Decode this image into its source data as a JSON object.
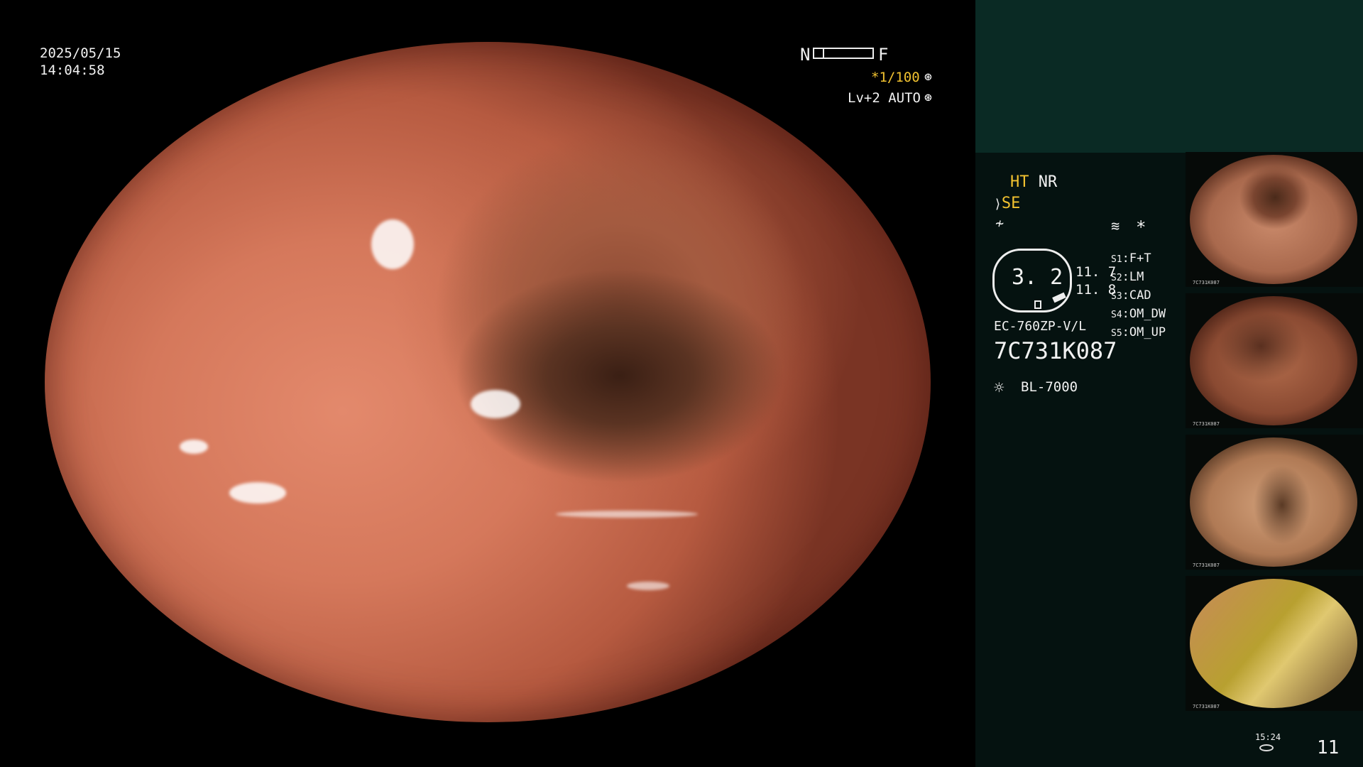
{
  "header": {
    "date": "2025/05/15",
    "time": "14:04:58"
  },
  "topright": {
    "near_label": "N",
    "far_label": "F",
    "shutter": "*1/100",
    "level": "Lv+2",
    "iris": "AUTO"
  },
  "status": {
    "ht": "HT",
    "nr": "NR",
    "se": "SE",
    "zoom": "3. 2",
    "val1": "11. 7",
    "val2": "11. 8",
    "scope_model": "EC-760ZP-V/L",
    "serial": "7C731K087",
    "light_source": "BL-7000",
    "asterisk": "*"
  },
  "switches": [
    {
      "key": "S1",
      "value": "F+T"
    },
    {
      "key": "S2",
      "value": "LM"
    },
    {
      "key": "S3",
      "value": "CAD"
    },
    {
      "key": "S4",
      "value": "OM_DW"
    },
    {
      "key": "S5",
      "value": "OM_UP"
    }
  ],
  "thumbnails": [
    {
      "stamp": "7C731K087"
    },
    {
      "stamp": "7C731K087"
    },
    {
      "stamp": "7C731K087"
    },
    {
      "stamp": "7C731K087"
    }
  ],
  "footer": {
    "small_time": "15:24",
    "count": "11"
  },
  "colors": {
    "accent_yellow": "#f2c230",
    "sidebar_bg": "#051210",
    "sidebar_top": "#0a2a24"
  }
}
